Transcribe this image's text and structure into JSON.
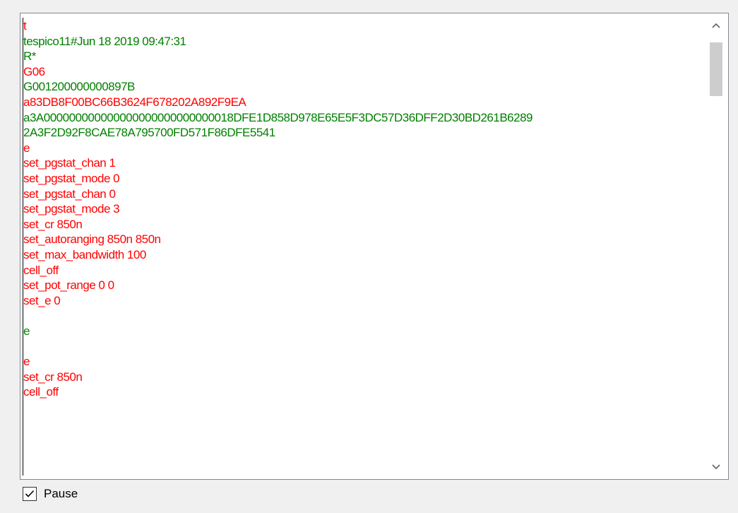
{
  "colors": {
    "sent": "#ff0000",
    "received": "#008000",
    "panel_border": "#828790",
    "window_bg": "#f0f0f0"
  },
  "log": {
    "lines": [
      {
        "text": "t",
        "type": "sent"
      },
      {
        "text": "tespico11#Jun 18 2019 09:47:31",
        "type": "received"
      },
      {
        "text": "R*",
        "type": "received"
      },
      {
        "text": "G06",
        "type": "sent"
      },
      {
        "text": "G001200000000897B",
        "type": "received"
      },
      {
        "text": "a83DB8F00BC66B3624F678202A892F9EA",
        "type": "sent"
      },
      {
        "text": "a3A000000000000000000000000000018DFE1D858D978E65E5F3DC57D36DFF2D30BD261B6289",
        "type": "received"
      },
      {
        "text": "2A3F2D92F8CAE78A795700FD571F86DFE5541",
        "type": "received"
      },
      {
        "text": "e",
        "type": "sent"
      },
      {
        "text": "set_pgstat_chan 1",
        "type": "sent"
      },
      {
        "text": "set_pgstat_mode 0",
        "type": "sent"
      },
      {
        "text": "set_pgstat_chan 0",
        "type": "sent"
      },
      {
        "text": "set_pgstat_mode 3",
        "type": "sent"
      },
      {
        "text": "set_cr 850n",
        "type": "sent"
      },
      {
        "text": "set_autoranging 850n 850n",
        "type": "sent"
      },
      {
        "text": "set_max_bandwidth 100",
        "type": "sent"
      },
      {
        "text": "cell_off",
        "type": "sent"
      },
      {
        "text": "set_pot_range 0 0",
        "type": "sent"
      },
      {
        "text": "set_e 0",
        "type": "sent"
      },
      {
        "text": "",
        "type": "sent"
      },
      {
        "text": "e",
        "type": "received"
      },
      {
        "text": "",
        "type": "sent"
      },
      {
        "text": "e",
        "type": "sent"
      },
      {
        "text": "set_cr 850n",
        "type": "sent"
      },
      {
        "text": "cell_off",
        "type": "sent"
      }
    ]
  },
  "scrollbar": {
    "up_icon": "chevron-up-icon",
    "down_icon": "chevron-down-icon"
  },
  "pause": {
    "label": "Pause",
    "checked": true,
    "icon": "checkmark-icon"
  }
}
